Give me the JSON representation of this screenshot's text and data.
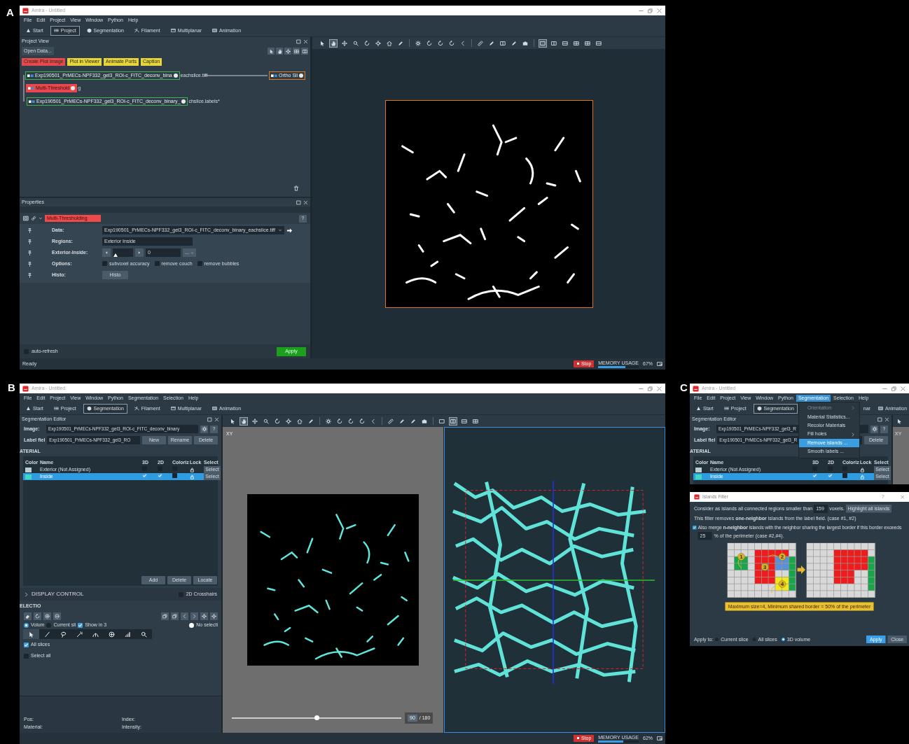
{
  "panel_a": {
    "label": "A",
    "window": {
      "title": "Amira - Untitled",
      "menu": [
        {
          "label": "File",
          "open": false
        },
        {
          "label": "Edit",
          "open": false
        },
        {
          "label": "Project",
          "open": false
        },
        {
          "label": "View",
          "open": false
        },
        {
          "label": "Window",
          "open": false
        },
        {
          "label": "Python",
          "open": false
        },
        {
          "label": "Help",
          "open": false
        }
      ],
      "workrooms": [
        {
          "label": "Start",
          "kind": "start",
          "selected": false
        },
        {
          "label": "Project",
          "kind": "project",
          "selected": true
        },
        {
          "label": "Segmentation",
          "kind": "segmentation",
          "selected": false
        },
        {
          "label": "Filament",
          "kind": "filament",
          "selected": false
        },
        {
          "label": "Multiplanar",
          "kind": "multiplanar",
          "selected": false
        },
        {
          "label": "Animation",
          "kind": "animation",
          "selected": false
        }
      ],
      "status": {
        "text": "Ready",
        "stop": "Stop",
        "memory_label": "MEMORY USAGE",
        "memory": "67%",
        "level": 0.67
      }
    },
    "project_view": {
      "title": "Project View",
      "open_data": "Open Data...",
      "actions": [
        {
          "label": "Create Plot Image",
          "color": "#e8484d"
        },
        {
          "label": "Plot in Viewer",
          "color": "#e6d43a"
        },
        {
          "label": "Animate Ports",
          "color": "#e6d43a"
        },
        {
          "label": "Caption",
          "color": "#e6d43a"
        }
      ],
      "nodes": [
        {
          "kind": "data",
          "label": "Exp190501_PrMECs-NPF332_gel3_ROI-c_FITC_deconv_bina",
          "trailing": "eachslice.tiff"
        },
        {
          "kind": "display",
          "label": "Ortho Sli"
        },
        {
          "kind": "compute",
          "label": "Multi-Threshold",
          "trailing": "g"
        },
        {
          "kind": "data",
          "label": "Exp190501_PrMECs-NPF332_gel3_ROI-c_FITC_deconv_binary_",
          "trailing": "chslice.labels*"
        }
      ]
    },
    "properties": {
      "title": "Properties",
      "module": "Multi-Thresholding",
      "help": "?",
      "ports": [
        {
          "kind": "dropdown",
          "label": "Data:",
          "value": "Exp190501_PrMECs-NPF332_gel3_ROI-c_FITC_deconv_binary_eachslice.tiff"
        },
        {
          "kind": "text",
          "label": "Regions:",
          "value": "Exterior Inside"
        },
        {
          "kind": "slider",
          "label": "Exterior-Inside:",
          "level": 0.05,
          "value": "0",
          "more": "..."
        },
        {
          "kind": "checks",
          "label": "Options:",
          "options": [
            {
              "label": "subvoxel accuracy",
              "checked": false
            },
            {
              "label": "remove couch",
              "checked": false
            },
            {
              "label": "remove bubbles",
              "checked": false
            }
          ]
        },
        {
          "kind": "button",
          "label": "Histo:",
          "button": "Histo"
        }
      ],
      "auto_refresh": {
        "label": "auto-refresh",
        "checked": false
      },
      "apply": "Apply"
    },
    "viewer": {
      "toolbar_groups": [
        [
          {
            "kind": "pointer",
            "selected": false
          },
          {
            "kind": "hand",
            "selected": true
          },
          {
            "kind": "move",
            "selected": false
          },
          {
            "kind": "magnifier",
            "selected": false
          },
          {
            "kind": "rotate",
            "selected": false
          },
          {
            "kind": "crosshair",
            "selected": false
          },
          {
            "kind": "house",
            "selected": false
          },
          {
            "kind": "pen",
            "selected": false
          }
        ],
        [
          {
            "kind": "gear",
            "selected": false
          },
          {
            "kind": "rotate",
            "selected": false
          },
          {
            "kind": "rotate",
            "selected": false
          },
          {
            "kind": "rotate",
            "selected": false
          },
          {
            "kind": "chevron-left",
            "selected": false
          }
        ],
        [
          {
            "kind": "ruler",
            "selected": false
          },
          {
            "kind": "pen",
            "selected": false
          },
          {
            "kind": "layout2",
            "selected": false
          },
          {
            "kind": "pen",
            "selected": false
          },
          {
            "kind": "camera",
            "selected": false
          }
        ],
        [
          {
            "kind": "layout1",
            "selected": true
          },
          {
            "kind": "layout2",
            "selected": false
          },
          {
            "kind": "layout3",
            "selected": false
          },
          {
            "kind": "layout4",
            "selected": false
          },
          {
            "kind": "layout4",
            "selected": false
          },
          {
            "kind": "layout3",
            "selected": false
          }
        ]
      ]
    }
  },
  "panel_b": {
    "label": "B",
    "window": {
      "title": "Amira - Untitled",
      "menu": [
        {
          "label": "File",
          "open": false
        },
        {
          "label": "Edit",
          "open": false
        },
        {
          "label": "Project",
          "open": false
        },
        {
          "label": "View",
          "open": false
        },
        {
          "label": "Window",
          "open": false
        },
        {
          "label": "Python",
          "open": false
        },
        {
          "label": "Segmentation",
          "open": false
        },
        {
          "label": "Selection",
          "open": false
        },
        {
          "label": "Help",
          "open": false
        }
      ],
      "workrooms": [
        {
          "label": "Start",
          "kind": "start",
          "selected": false
        },
        {
          "label": "Project",
          "kind": "project",
          "selected": false
        },
        {
          "label": "Segmentation",
          "kind": "segmentation",
          "selected": true
        },
        {
          "label": "Filament",
          "kind": "filament",
          "selected": false
        },
        {
          "label": "Multiplanar",
          "kind": "multiplanar",
          "selected": false
        },
        {
          "label": "Animation",
          "kind": "animation",
          "selected": false
        }
      ],
      "status": {
        "stop": "Stop",
        "memory_label": "MEMORY USAGE",
        "memory": "62%",
        "level": 0.62
      }
    },
    "seg_editor": {
      "title": "Segmentation Editor",
      "image_label": "Image:",
      "image": "Exp190501_PrMECs-NPF332_gel3_ROI-c_FITC_deconv_binary",
      "help": "?",
      "label_field_label": "Label fiel",
      "label_field": "Exp190501_PrMECs-NPF332_gel3_RO",
      "label_buttons": [
        "New",
        "Rename",
        "Delete"
      ],
      "section": "ATERIAL",
      "columns": [
        "Color",
        "Name",
        "3D",
        "2D",
        "Coloriz",
        "Lock",
        "Select"
      ],
      "materials": [
        {
          "name": "Exterior (Not Assigned)",
          "color": "#b9cfcf",
          "show_3d": false,
          "show_2d": false,
          "colorize": false,
          "select": "Select",
          "selected": false
        },
        {
          "name": "Inside",
          "color": "#3ed9c2",
          "show_3d": true,
          "show_2d": true,
          "colorize": false,
          "select": "Select",
          "selected": true
        }
      ],
      "material_buttons": [
        "Add",
        "Delete",
        "Locate"
      ],
      "display_control": {
        "label": "DISPLAY CONTROL",
        "crosshairs": {
          "label": "2D Crosshairs",
          "checked": false
        }
      },
      "selection": {
        "section": "ELECTIO",
        "modes": [
          {
            "label": "Volum",
            "selected": true
          },
          {
            "label": "Current sli",
            "selected": false
          }
        ],
        "show_in_3d": {
          "label": "Show in 3",
          "checked": true
        },
        "no_selection": {
          "label": "No selecti",
          "on": true
        },
        "tools": [
          {
            "kind": "pointer",
            "selected": true
          },
          {
            "kind": "brush",
            "selected": false
          },
          {
            "kind": "lasso",
            "selected": false
          },
          {
            "kind": "wand",
            "selected": false
          },
          {
            "kind": "arc",
            "selected": false
          },
          {
            "kind": "plus-circle",
            "selected": false
          },
          {
            "kind": "histogram",
            "selected": false
          },
          {
            "kind": "magnifier",
            "selected": false
          }
        ],
        "all_slices": {
          "label": "All slices",
          "checked": true
        },
        "select_all": {
          "label": "Select all",
          "checked": false
        }
      },
      "info": [
        "Pos:",
        "Index:",
        "Material:",
        "Intensity:"
      ]
    },
    "viewer": {
      "toolbar_groups": [
        [
          {
            "kind": "pointer",
            "selected": false
          },
          {
            "kind": "hand",
            "selected": true
          },
          {
            "kind": "move",
            "selected": false
          },
          {
            "kind": "magnifier",
            "selected": false
          },
          {
            "kind": "rotate",
            "selected": false
          },
          {
            "kind": "crosshair",
            "selected": false
          },
          {
            "kind": "house",
            "selected": false
          },
          {
            "kind": "pen",
            "selected": false
          }
        ],
        [
          {
            "kind": "gear",
            "selected": false
          },
          {
            "kind": "rotate",
            "selected": false
          },
          {
            "kind": "rotate",
            "selected": false
          },
          {
            "kind": "rotate",
            "selected": false
          },
          {
            "kind": "chevron-left",
            "selected": false
          }
        ],
        [
          {
            "kind": "ruler",
            "selected": false
          },
          {
            "kind": "pen",
            "selected": false
          },
          {
            "kind": "pen",
            "selected": false
          },
          {
            "kind": "camera",
            "selected": false
          }
        ],
        [
          {
            "kind": "layout1",
            "selected": false
          },
          {
            "kind": "layout2",
            "selected": true
          },
          {
            "kind": "layout3",
            "selected": false
          },
          {
            "kind": "layout4",
            "selected": false
          }
        ]
      ],
      "view_label": "XY",
      "slice": {
        "level": 0.5,
        "value": "90",
        "total": "/ 180"
      }
    }
  },
  "panel_c": {
    "label": "C",
    "window": {
      "title": "Amira - Untitled",
      "menu": [
        {
          "label": "File",
          "open": false
        },
        {
          "label": "Edit",
          "open": false
        },
        {
          "label": "Project",
          "open": false
        },
        {
          "label": "View",
          "open": false
        },
        {
          "label": "Window",
          "open": false
        },
        {
          "label": "Python",
          "open": false
        },
        {
          "label": "Segmentation",
          "open": true,
          "items": [
            {
              "label": "Orientation",
              "disabled": true,
              "submenu": true,
              "selected": false
            },
            {
              "label": "Material Statistics...",
              "disabled": false,
              "submenu": false,
              "selected": false
            },
            {
              "label": "Recolor Materials",
              "disabled": false,
              "submenu": false,
              "selected": false
            },
            {
              "label": "Fill holes",
              "disabled": false,
              "submenu": true,
              "selected": false
            },
            {
              "label": "Remove islands ...",
              "disabled": false,
              "submenu": false,
              "selected": true
            },
            {
              "label": "Smooth labels ...",
              "disabled": false,
              "submenu": false,
              "selected": false
            }
          ]
        },
        {
          "label": "Selection",
          "open": false
        },
        {
          "label": "Help",
          "open": false
        }
      ],
      "workrooms": [
        {
          "label": "Start",
          "kind": "start",
          "selected": false
        },
        {
          "label": "Project",
          "kind": "project",
          "selected": false
        },
        {
          "label": "Segmentation",
          "kind": "segmentation",
          "selected": true
        },
        {
          "label": "nar",
          "kind": "cut",
          "selected": false
        },
        {
          "label": "Animation",
          "kind": "animation",
          "selected": false
        }
      ]
    },
    "seg_editor": {
      "title": "Segmentation Editor",
      "image_label": "Image:",
      "image": "Exp190501_PrMECs-NPF332_gel3_R",
      "help": "?",
      "label_field_label": "Label fiel",
      "label_field": "Exp190501_PrMECs-NPF332_gel3_R",
      "label_buttons": [
        "Delete"
      ],
      "section": "ATERIAL",
      "columns": [
        "Color",
        "Name",
        "3D",
        "2D",
        "Coloriz",
        "Lock",
        "Select"
      ],
      "materials": [
        {
          "name": "Exterior (Not Assigned)",
          "color": "#b9cfcf",
          "show_3d": false,
          "show_2d": false,
          "colorize": false,
          "select": "Select",
          "selected": false
        },
        {
          "name": "Inside",
          "color": "#3ed9c2",
          "show_3d": true,
          "show_2d": true,
          "colorize": false,
          "select": "Select",
          "selected": true
        }
      ]
    },
    "viewer": {
      "toolbar_groups": [
        [
          {
            "kind": "pointer",
            "selected": false
          }
        ]
      ],
      "view_label": "XY"
    },
    "dialog": {
      "title": "Islands Filter",
      "help": "?",
      "size_text": "Consider as islands all connected regions smaller than",
      "size": "159",
      "size_unit": "voxels.",
      "highlight": "Highlight all islands",
      "note": "This filter removes **one-neighbor** islands from the label field. (case #1, #2)",
      "merge": {
        "checked": true,
        "text": "Also merge **n-neighbor** islands with the neighbor sharing the largest border if this border exceeds",
        "value": "25",
        "unit": "% of the perimeter (case #2,#4)."
      },
      "diagram": {
        "marks": [
          "1",
          "2",
          "3",
          "4"
        ],
        "caption": "Maximum size=4, Minimum shared border = 50% of the perimeter"
      },
      "apply_to": {
        "label": "Apply to:",
        "options": [
          {
            "label": "Current slice",
            "selected": false
          },
          {
            "label": "All slices",
            "selected": false
          },
          {
            "label": "3D volume",
            "selected": true
          }
        ]
      },
      "buttons": [
        {
          "label": "Apply",
          "kind": "primary"
        },
        {
          "label": "Close",
          "kind": "secondary"
        }
      ]
    }
  }
}
